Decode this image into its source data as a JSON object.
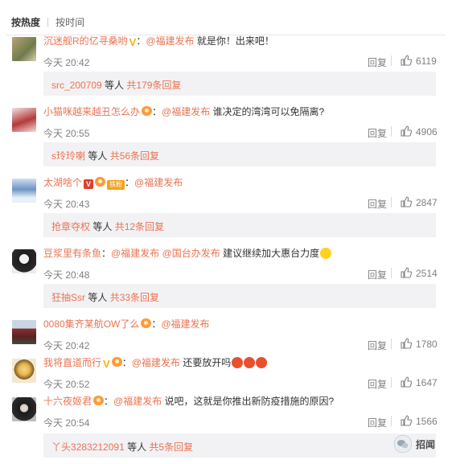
{
  "sort": {
    "hot": "按热度",
    "time": "按时间"
  },
  "comments": [
    {
      "user": "沉迷舰R的亿寻桑哟",
      "mention": "@福建发布",
      "text": " 就是你！出来吧！",
      "time": "今天 20:42",
      "reply": "回复",
      "likes": "6119",
      "sub": {
        "user": "src_200709",
        "mid": " 等人 ",
        "count": "共179条回复"
      }
    },
    {
      "user": "小猫咪越来越丑怎么办",
      "mention": "@福建发布",
      "text": " 谁决定的湾湾可以免隔离?",
      "time": "今天 20:55",
      "reply": "回复",
      "likes": "4906",
      "sub": {
        "user": "s玲玲喇",
        "mid": " 等人 ",
        "count": "共56条回复"
      }
    },
    {
      "user": "太湖啥个",
      "mention": "@福建发布",
      "text": "",
      "time": "今天 20:43",
      "reply": "回复",
      "likes": "2847",
      "sub": {
        "user": "抢章夺权",
        "mid": " 等人 ",
        "count": "共12条回复"
      }
    },
    {
      "user": "豆浆里有条鱼",
      "mention": "@福建发布",
      "mention2": "@国台办发布",
      "text": " 建议继续加大惠台力度",
      "time": "今天 20:48",
      "reply": "回复",
      "likes": "2514",
      "sub": {
        "user": "狂抽Ssr",
        "mid": " 等人 ",
        "count": "共33条回复"
      }
    },
    {
      "user": "0080集齐某航OW了么",
      "mention": "@福建发布",
      "text": "",
      "time": "今天 20:42",
      "reply": "回复",
      "likes": "1780"
    },
    {
      "user": "我将直道而行",
      "mention": "@福建发布",
      "text": " 还要放开吗",
      "time": "今天 20:52",
      "reply": "回复",
      "likes": "1647"
    },
    {
      "user": "十六夜姬君",
      "mention": "@福建发布",
      "text": " 说吧，这就是你推出新防疫措施的原因?",
      "time": "今天 20:54",
      "reply": "回复",
      "likes": "1566",
      "sub": {
        "user": "丫头3283212091",
        "mid": " 等人 ",
        "count": "共5条回复"
      }
    }
  ],
  "badges": {
    "v_mark": "V",
    "v_box": "V",
    "fan_label": "铁粉"
  },
  "icons": {
    "like": "thumbs-up-icon",
    "watermark": "wechat-logo-icon"
  },
  "colors": {
    "link": "#eb7350",
    "subbox": "#f2f2f5",
    "vip": "#f7b300"
  },
  "watermark": {
    "text": "招闻"
  }
}
